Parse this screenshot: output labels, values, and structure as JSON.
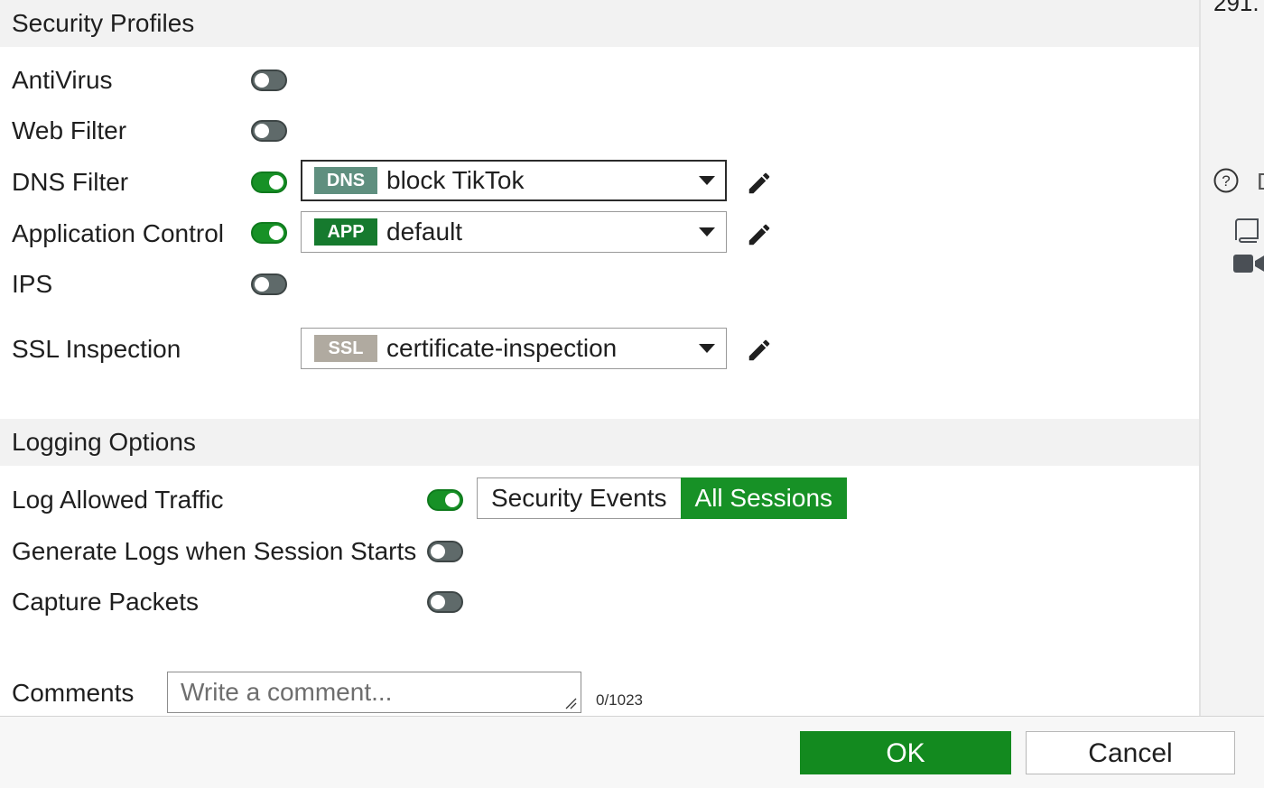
{
  "security_profiles": {
    "title": "Security Profiles",
    "rows": {
      "antivirus": {
        "label": "AntiVirus",
        "enabled": false
      },
      "web_filter": {
        "label": "Web Filter",
        "enabled": false
      },
      "dns_filter": {
        "label": "DNS Filter",
        "enabled": true,
        "badge": "DNS",
        "badge_color": "#5f8f7f",
        "value": "block TikTok"
      },
      "application_control": {
        "label": "Application Control",
        "enabled": true,
        "badge": "APP",
        "badge_color": "#167a2e",
        "value": "default"
      },
      "ips": {
        "label": "IPS",
        "enabled": false
      },
      "ssl_inspection": {
        "label": "SSL Inspection",
        "badge": "SSL",
        "badge_color": "#b0aaa0",
        "value": "certificate-inspection"
      }
    }
  },
  "logging_options": {
    "title": "Logging Options",
    "log_allowed_traffic": {
      "label": "Log Allowed Traffic",
      "enabled": true,
      "options": [
        "Security Events",
        "All Sessions"
      ],
      "selected": "All Sessions"
    },
    "generate_logs": {
      "label": "Generate Logs when Session Starts",
      "enabled": false
    },
    "capture_packets": {
      "label": "Capture Packets",
      "enabled": false
    }
  },
  "comments": {
    "label": "Comments",
    "placeholder": "Write a comment...",
    "count": "0/1023"
  },
  "footer": {
    "ok_label": "OK",
    "cancel_label": "Cancel"
  },
  "side_panel": {
    "top_text": "291.",
    "help_text": "D"
  },
  "colors": {
    "accent_green": "#179126",
    "toggle_off": "#5f6a6a",
    "section_bg": "#f2f2f2"
  },
  "icons": [
    "edit-icon",
    "help-icon",
    "book-icon",
    "video-icon",
    "caret-down-icon"
  ]
}
